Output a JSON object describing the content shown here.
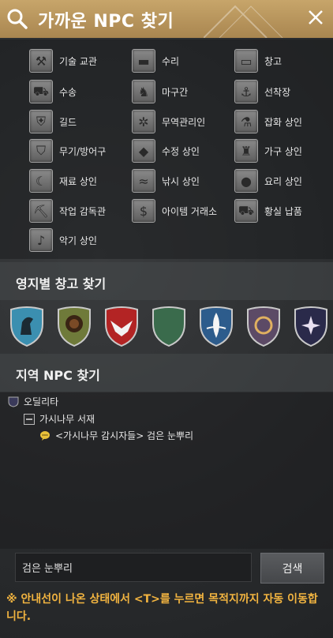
{
  "header": {
    "title": "가까운 NPC 찾기"
  },
  "services": [
    {
      "label": "기술 교관",
      "icon": "tools-icon"
    },
    {
      "label": "수리",
      "icon": "anvil-icon"
    },
    {
      "label": "창고",
      "icon": "chest-icon"
    },
    {
      "label": "수송",
      "icon": "wagon-icon"
    },
    {
      "label": "마구간",
      "icon": "horse-icon"
    },
    {
      "label": "선착장",
      "icon": "anchor-icon"
    },
    {
      "label": "길드",
      "icon": "guild-shield-icon"
    },
    {
      "label": "무역관리인",
      "icon": "wheel-icon"
    },
    {
      "label": "잡화 상인",
      "icon": "flask-icon"
    },
    {
      "label": "무기/방어구",
      "icon": "armor-icon"
    },
    {
      "label": "수정 상인",
      "icon": "crystal-icon"
    },
    {
      "label": "가구 상인",
      "icon": "chair-icon"
    },
    {
      "label": "재료 상인",
      "icon": "sickle-icon"
    },
    {
      "label": "낚시 상인",
      "icon": "fish-icon"
    },
    {
      "label": "요리 상인",
      "icon": "roast-icon"
    },
    {
      "label": "작업 감독관",
      "icon": "pickaxe-icon"
    },
    {
      "label": "아이템 거래소",
      "icon": "money-bag-icon"
    },
    {
      "label": "황실 납품",
      "icon": "cart-icon"
    },
    {
      "label": "악기 상인",
      "icon": "instrument-icon"
    }
  ],
  "territory": {
    "title": "영지별 창고 찾기",
    "shields": [
      {
        "name": "horse-crest",
        "bg": "#3b8fb0",
        "fg": "#1c2a33"
      },
      {
        "name": "lion-crest",
        "bg": "#6f7a3a",
        "fg": "#3a2414"
      },
      {
        "name": "eagle-crest",
        "bg": "#b32424",
        "fg": "#f2f2f2"
      },
      {
        "name": "moon-crest",
        "bg": "#3a6b4c",
        "fg": "#e8d48a"
      },
      {
        "name": "lily-crest",
        "bg": "#2d5c8c",
        "fg": "#f5f5f5"
      },
      {
        "name": "wreath-crest",
        "bg": "#5c4a66",
        "fg": "#e0b060"
      },
      {
        "name": "star-crest",
        "bg": "#2a2a4a",
        "fg": "#e8e0f0"
      }
    ]
  },
  "region": {
    "title": "지역 NPC 찾기",
    "root": "오딜리타",
    "child": "가시나무 서재",
    "leaf": "<가시나무 감시자들> 검은 눈뿌리"
  },
  "search": {
    "value": "검은 눈뿌리",
    "button": "검색"
  },
  "notice": "※ 안내선이 나온 상태에서 <T>를 누르면 목적지까지 자동 이동합니다."
}
